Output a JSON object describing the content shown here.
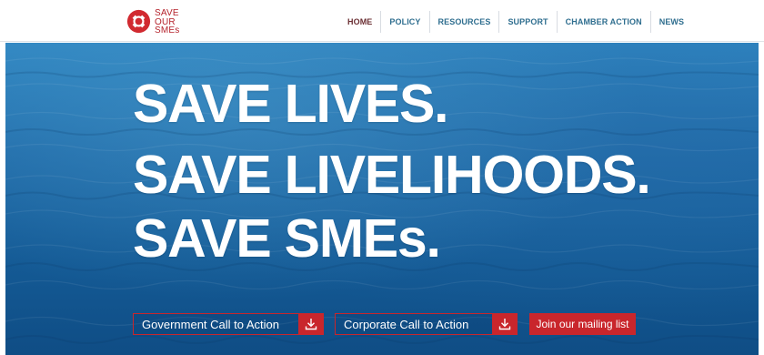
{
  "logo": {
    "line1": "SAVE",
    "line2": "OUR",
    "line3": "SMEs",
    "icon": "lifebuoy-icon",
    "brand_color": "#b5232c"
  },
  "nav": {
    "items": [
      {
        "label": "HOME"
      },
      {
        "label": "POLICY"
      },
      {
        "label": "RESOURCES"
      },
      {
        "label": "SUPPORT"
      },
      {
        "label": "CHAMBER ACTION"
      },
      {
        "label": "NEWS"
      }
    ],
    "active": "HOME"
  },
  "hero": {
    "line1": "SAVE LIVES.",
    "line2": "SAVE LIVELIHOODS.",
    "line3": "SAVE SMEs."
  },
  "actions": {
    "government_label": "Government Call to Action",
    "corporate_label": "Corporate Call to Action",
    "mailing_label": "Join our mailing list",
    "download_icon": "download-icon",
    "accent_color": "#c9262c"
  }
}
